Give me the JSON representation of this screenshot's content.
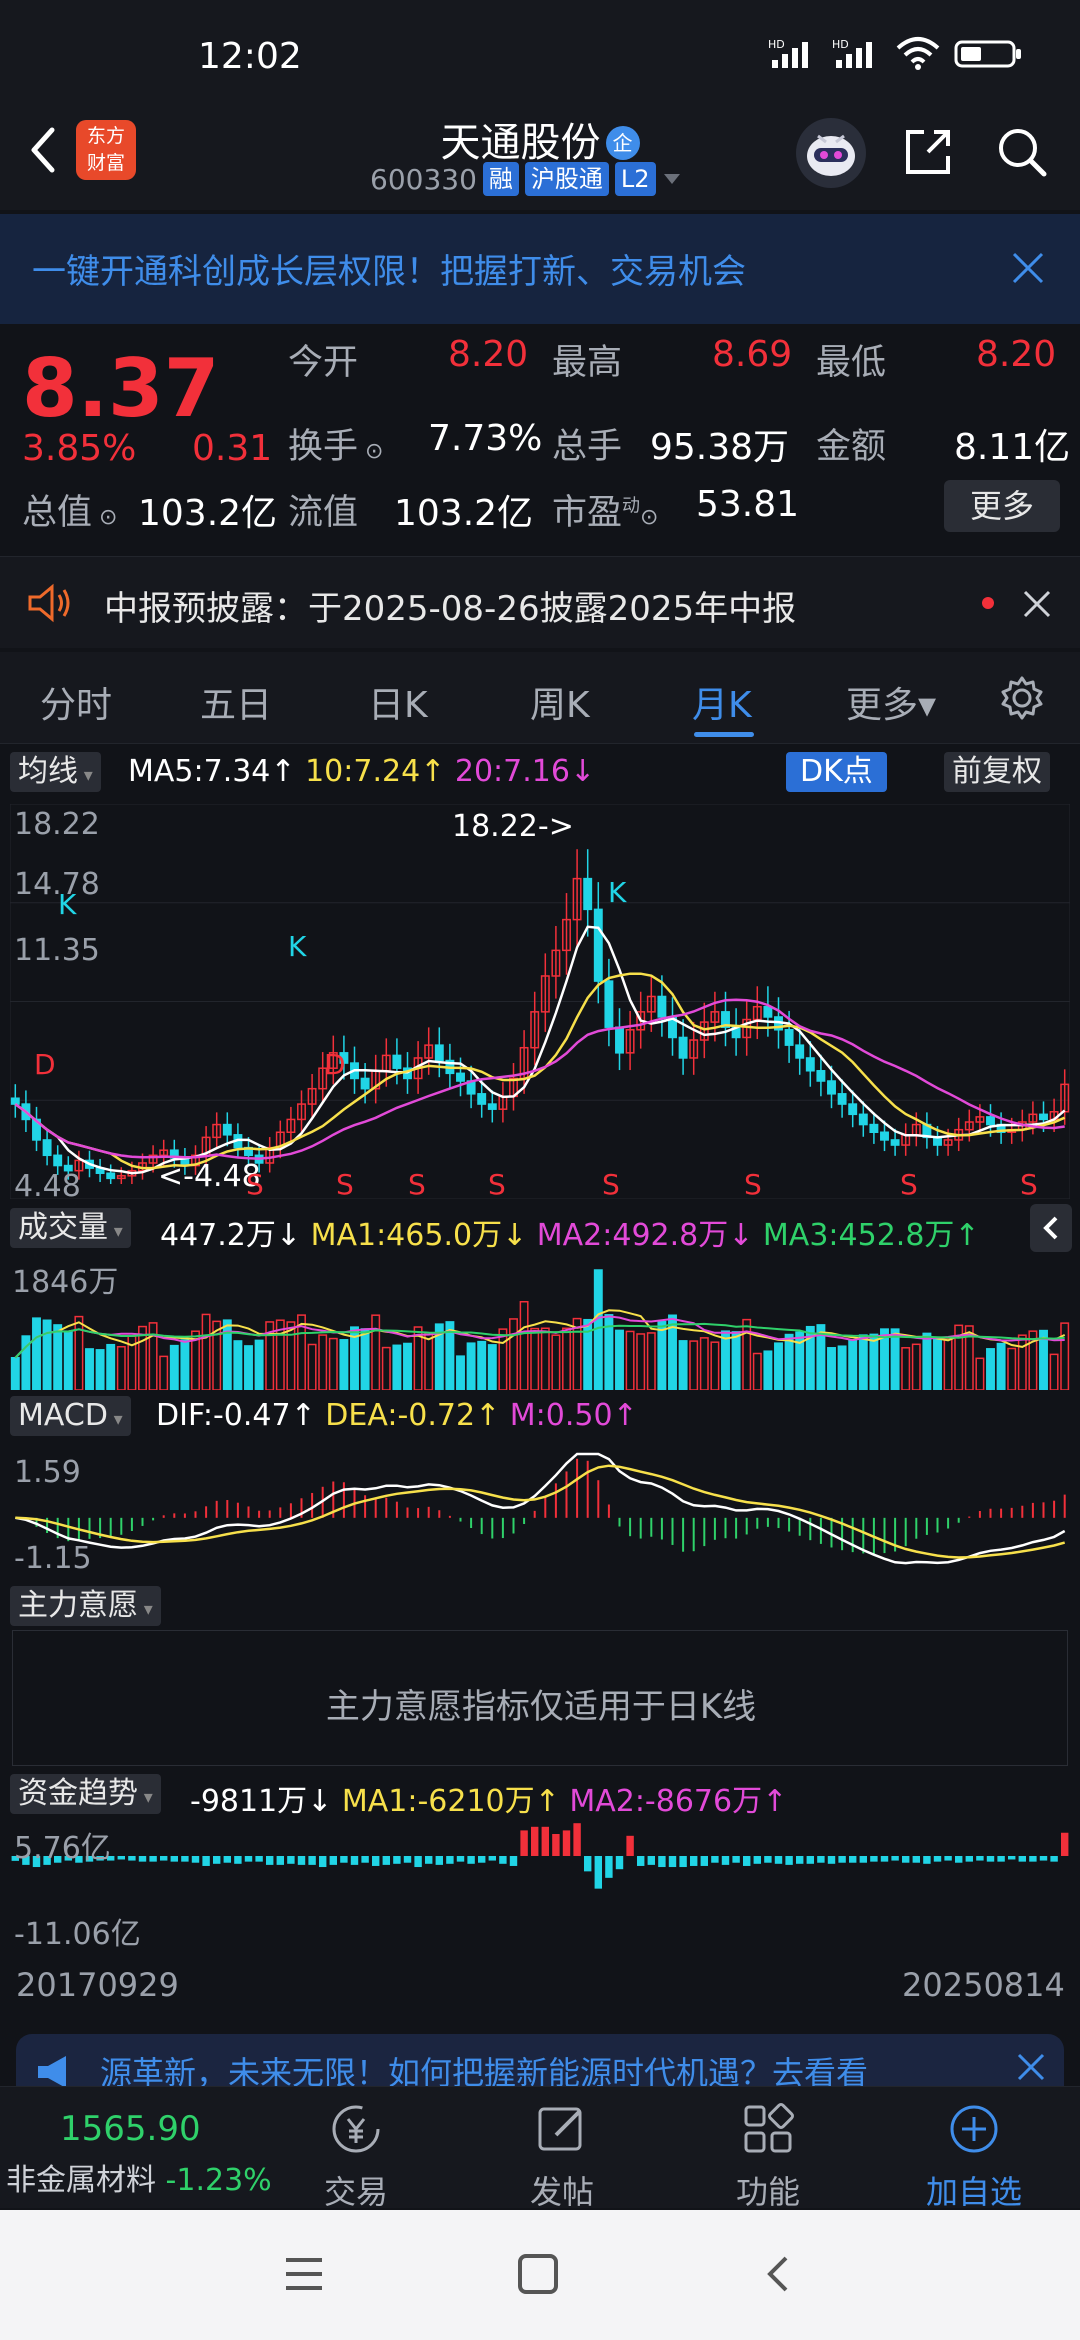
{
  "status": {
    "time": "12:02",
    "hd1": "HD",
    "hd2": "HD"
  },
  "header": {
    "logo": "东方财富",
    "logo_line1": "东方",
    "logo_line2": "财富",
    "stock_name": "天通股份",
    "name_badge": "企",
    "stock_code": "600330",
    "tag_margin": "融",
    "tag_connect": "沪股通",
    "tag_level": "L2"
  },
  "banner": {
    "text": "一键开通科创成长层权限！把握打新、交易机会"
  },
  "quote": {
    "price": "8.37",
    "change_pct": "3.85%",
    "change_abs": "0.31",
    "open_label": "今开",
    "open": "8.20",
    "high_label": "最高",
    "high": "8.69",
    "low_label": "最低",
    "low": "8.20",
    "turnover_label": "换手",
    "turnover": "7.73%",
    "volume_label": "总手",
    "volume": "95.38万",
    "amount_label": "金额",
    "amount": "8.11亿",
    "total_cap_label": "总值",
    "total_cap": "103.2亿",
    "float_cap_label": "流值",
    "float_cap": "103.2亿",
    "pe_label": "市盈",
    "pe_sup": "动",
    "pe": "53.81",
    "more_label": "更多"
  },
  "notice": {
    "text": "中报预披露：于2025-08-26披露2025年中报"
  },
  "tabs": [
    "分时",
    "五日",
    "日K",
    "周K",
    "月K",
    "更多▾"
  ],
  "active_tab": 4,
  "ma_bar": {
    "btn": "均线",
    "ma5": "MA5:7.34↑",
    "ma10": "10:7.24↑",
    "ma20": "20:7.16↓",
    "dk": "DK点",
    "adjust": "前复权"
  },
  "main_chart": {
    "y_labels": [
      "18.22",
      "14.78",
      "11.35",
      "4.48"
    ],
    "max_label": "18.22->",
    "min_label": "<-4.48",
    "k_marks": [
      "K",
      "K",
      "K"
    ],
    "d_marks": [
      "D",
      "D"
    ],
    "s_marks": [
      "S",
      "S",
      "S",
      "S",
      "S",
      "S",
      "S",
      "S"
    ]
  },
  "vol_bar": {
    "btn": "成交量",
    "val": "447.2万↓",
    "ma1": "MA1:465.0万↓",
    "ma2": "MA2:492.8万↓",
    "ma3": "MA3:452.8万↑",
    "y_label": "1846万"
  },
  "macd_bar": {
    "btn": "MACD",
    "dif": "DIF:-0.47↑",
    "dea": "DEA:-0.72↑",
    "m": "M:0.50↑",
    "y_top": "1.59",
    "y_bottom": "-1.15"
  },
  "main_power": {
    "btn": "主力意愿",
    "note": "主力意愿指标仅适用于日K线"
  },
  "fund_bar": {
    "btn": "资金趋势",
    "val": "-9811万↓",
    "ma1": "MA1:-6210万↑",
    "ma2": "MA2:-8676万↑",
    "y_top": "5.76亿",
    "y_bottom": "-11.06亿"
  },
  "dates": {
    "start": "20170929",
    "end": "20250814"
  },
  "ad": {
    "text": "源革新，未来无限！如何把握新能源时代机遇？去看看"
  },
  "bottom_bar": {
    "index_value": "1565.90",
    "index_name": "非金属材料",
    "index_change": "-1.23%",
    "trade": "交易",
    "post": "发帖",
    "function": "功能",
    "add_watch": "加自选"
  },
  "colors": {
    "up": "#f2303a",
    "down": "#2fd16a",
    "accent": "#3f8dea",
    "cyan": "#21d5e6",
    "yellow": "#f7e04b",
    "magenta": "#e24ad8"
  },
  "chart_data": {
    "type": "candlestick",
    "period": "monthly",
    "range": [
      "20170929",
      "20250814"
    ],
    "y_max_label": 18.22,
    "y_min_label": 4.48,
    "closes": [
      7.6,
      7.0,
      6.2,
      5.6,
      5.2,
      5.0,
      5.4,
      5.1,
      4.9,
      4.7,
      4.8,
      5.0,
      5.3,
      5.6,
      5.8,
      5.5,
      5.2,
      5.6,
      6.3,
      6.8,
      6.4,
      5.9,
      5.6,
      5.3,
      5.9,
      6.5,
      7.0,
      7.6,
      8.2,
      9.0,
      9.6,
      9.2,
      8.6,
      8.2,
      8.9,
      9.5,
      9.0,
      8.6,
      9.4,
      9.9,
      9.3,
      8.8,
      8.5,
      8.0,
      7.6,
      7.4,
      7.9,
      8.6,
      9.8,
      11.2,
      12.6,
      13.6,
      14.8,
      16.4,
      15.2,
      12.4,
      10.6,
      9.6,
      10.5,
      11.2,
      11.8,
      11.0,
      10.2,
      9.4,
      10.1,
      10.8,
      11.2,
      10.6,
      10.2,
      10.9,
      11.4,
      11.0,
      10.5,
      9.9,
      9.4,
      8.9,
      8.5,
      8.0,
      7.6,
      7.2,
      6.8,
      6.5,
      6.2,
      6.0,
      6.4,
      6.8,
      6.3,
      6.0,
      6.2,
      6.6,
      6.9,
      7.1,
      6.8,
      6.5,
      6.6,
      6.9,
      7.2,
      7.0,
      7.3,
      8.37
    ],
    "volume_max_label": "1846万",
    "macd_range": [
      -1.15,
      1.59
    ]
  }
}
